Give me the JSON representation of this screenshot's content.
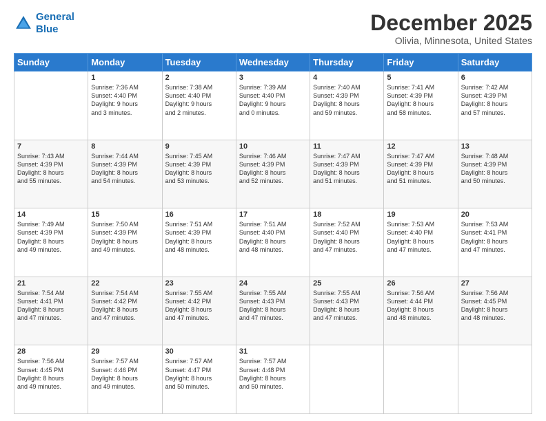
{
  "logo": {
    "line1": "General",
    "line2": "Blue"
  },
  "header": {
    "title": "December 2025",
    "subtitle": "Olivia, Minnesota, United States"
  },
  "days_of_week": [
    "Sunday",
    "Monday",
    "Tuesday",
    "Wednesday",
    "Thursday",
    "Friday",
    "Saturday"
  ],
  "weeks": [
    [
      {
        "day": "",
        "content": ""
      },
      {
        "day": "1",
        "content": "Sunrise: 7:36 AM\nSunset: 4:40 PM\nDaylight: 9 hours\nand 3 minutes."
      },
      {
        "day": "2",
        "content": "Sunrise: 7:38 AM\nSunset: 4:40 PM\nDaylight: 9 hours\nand 2 minutes."
      },
      {
        "day": "3",
        "content": "Sunrise: 7:39 AM\nSunset: 4:40 PM\nDaylight: 9 hours\nand 0 minutes."
      },
      {
        "day": "4",
        "content": "Sunrise: 7:40 AM\nSunset: 4:39 PM\nDaylight: 8 hours\nand 59 minutes."
      },
      {
        "day": "5",
        "content": "Sunrise: 7:41 AM\nSunset: 4:39 PM\nDaylight: 8 hours\nand 58 minutes."
      },
      {
        "day": "6",
        "content": "Sunrise: 7:42 AM\nSunset: 4:39 PM\nDaylight: 8 hours\nand 57 minutes."
      }
    ],
    [
      {
        "day": "7",
        "content": "Sunrise: 7:43 AM\nSunset: 4:39 PM\nDaylight: 8 hours\nand 55 minutes."
      },
      {
        "day": "8",
        "content": "Sunrise: 7:44 AM\nSunset: 4:39 PM\nDaylight: 8 hours\nand 54 minutes."
      },
      {
        "day": "9",
        "content": "Sunrise: 7:45 AM\nSunset: 4:39 PM\nDaylight: 8 hours\nand 53 minutes."
      },
      {
        "day": "10",
        "content": "Sunrise: 7:46 AM\nSunset: 4:39 PM\nDaylight: 8 hours\nand 52 minutes."
      },
      {
        "day": "11",
        "content": "Sunrise: 7:47 AM\nSunset: 4:39 PM\nDaylight: 8 hours\nand 51 minutes."
      },
      {
        "day": "12",
        "content": "Sunrise: 7:47 AM\nSunset: 4:39 PM\nDaylight: 8 hours\nand 51 minutes."
      },
      {
        "day": "13",
        "content": "Sunrise: 7:48 AM\nSunset: 4:39 PM\nDaylight: 8 hours\nand 50 minutes."
      }
    ],
    [
      {
        "day": "14",
        "content": "Sunrise: 7:49 AM\nSunset: 4:39 PM\nDaylight: 8 hours\nand 49 minutes."
      },
      {
        "day": "15",
        "content": "Sunrise: 7:50 AM\nSunset: 4:39 PM\nDaylight: 8 hours\nand 49 minutes."
      },
      {
        "day": "16",
        "content": "Sunrise: 7:51 AM\nSunset: 4:39 PM\nDaylight: 8 hours\nand 48 minutes."
      },
      {
        "day": "17",
        "content": "Sunrise: 7:51 AM\nSunset: 4:40 PM\nDaylight: 8 hours\nand 48 minutes."
      },
      {
        "day": "18",
        "content": "Sunrise: 7:52 AM\nSunset: 4:40 PM\nDaylight: 8 hours\nand 47 minutes."
      },
      {
        "day": "19",
        "content": "Sunrise: 7:53 AM\nSunset: 4:40 PM\nDaylight: 8 hours\nand 47 minutes."
      },
      {
        "day": "20",
        "content": "Sunrise: 7:53 AM\nSunset: 4:41 PM\nDaylight: 8 hours\nand 47 minutes."
      }
    ],
    [
      {
        "day": "21",
        "content": "Sunrise: 7:54 AM\nSunset: 4:41 PM\nDaylight: 8 hours\nand 47 minutes."
      },
      {
        "day": "22",
        "content": "Sunrise: 7:54 AM\nSunset: 4:42 PM\nDaylight: 8 hours\nand 47 minutes."
      },
      {
        "day": "23",
        "content": "Sunrise: 7:55 AM\nSunset: 4:42 PM\nDaylight: 8 hours\nand 47 minutes."
      },
      {
        "day": "24",
        "content": "Sunrise: 7:55 AM\nSunset: 4:43 PM\nDaylight: 8 hours\nand 47 minutes."
      },
      {
        "day": "25",
        "content": "Sunrise: 7:55 AM\nSunset: 4:43 PM\nDaylight: 8 hours\nand 47 minutes."
      },
      {
        "day": "26",
        "content": "Sunrise: 7:56 AM\nSunset: 4:44 PM\nDaylight: 8 hours\nand 48 minutes."
      },
      {
        "day": "27",
        "content": "Sunrise: 7:56 AM\nSunset: 4:45 PM\nDaylight: 8 hours\nand 48 minutes."
      }
    ],
    [
      {
        "day": "28",
        "content": "Sunrise: 7:56 AM\nSunset: 4:45 PM\nDaylight: 8 hours\nand 49 minutes."
      },
      {
        "day": "29",
        "content": "Sunrise: 7:57 AM\nSunset: 4:46 PM\nDaylight: 8 hours\nand 49 minutes."
      },
      {
        "day": "30",
        "content": "Sunrise: 7:57 AM\nSunset: 4:47 PM\nDaylight: 8 hours\nand 50 minutes."
      },
      {
        "day": "31",
        "content": "Sunrise: 7:57 AM\nSunset: 4:48 PM\nDaylight: 8 hours\nand 50 minutes."
      },
      {
        "day": "",
        "content": ""
      },
      {
        "day": "",
        "content": ""
      },
      {
        "day": "",
        "content": ""
      }
    ]
  ]
}
